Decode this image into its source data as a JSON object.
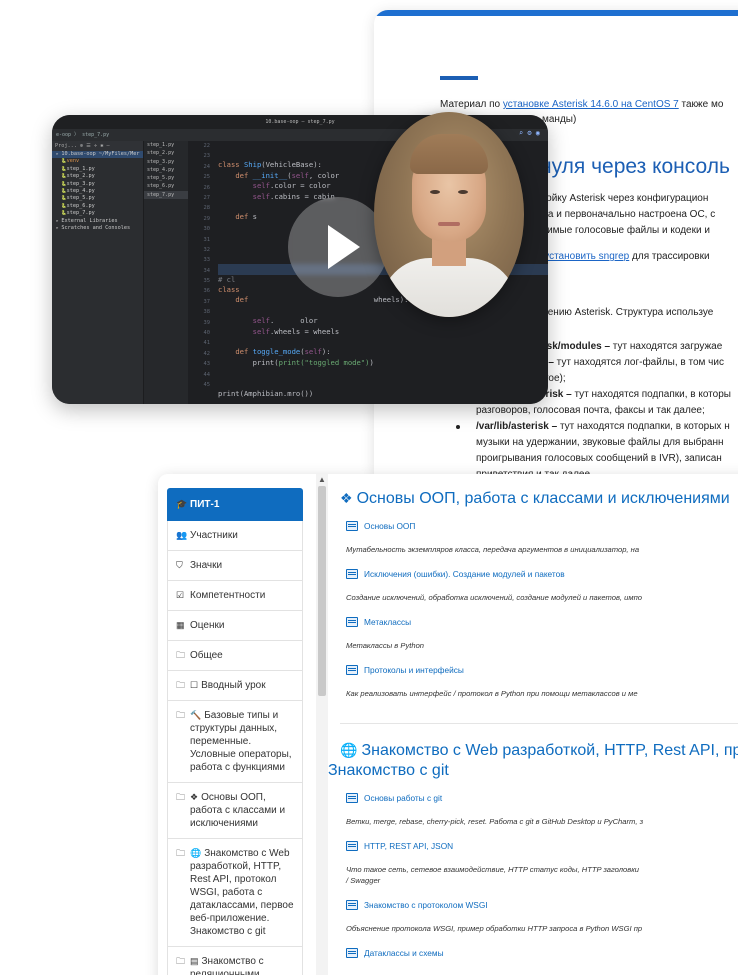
{
  "doc": {
    "material_prefix": "Материал по ",
    "material_link": "установке Asterisk 14.6.0 на CentOS 7",
    "material_suffix": " также мо",
    "material_line2": "манды)",
    "heading": "нуля через консоль",
    "para1": "стройку Asterisk через конфигурацион",
    "para2": "лена и первоначально настроена ОС, с",
    "para3": "ходимые голосовые файлы и кодеки и",
    "para4_prefix": "ся ",
    "para4_link": "установить sngrep",
    "para4_suffix": " для трассировки",
    "para5": "едрению Asterisk. Структура используе",
    "li1_bold": "risk/modules –",
    "li1_text": " тут находятся загружае",
    "li2_bold": "k –",
    "li2_text": " тут находятся лог-файлы, в том чис",
    "li2_line2": "угое);",
    "li3_bold": "erisk –",
    "li3_text": " тут находятся подпапки, в которы",
    "li3_line2": "разговоров, голосовая почта, факсы и так далее;",
    "li4_bold": "/var/lib/asterisk –",
    "li4_text": " тут находятся подпапки, в которых н",
    "li4_line2": "музыки на удержании, звуковые файлы для выбранн",
    "li4_line3": "проигрывания голосовых сообщений в IVR), записан",
    "li4_line4": "приветствия и так далее"
  },
  "ide": {
    "window_title": "10.base-oop – step_7.py",
    "breadcrumb": "e-oop 〉 step_7.py",
    "project_header": "Proj...  ⊕  ☰  ÷  ✱  —",
    "tree": [
      {
        "label": "10.base-oop ~/MyFiles/Mer",
        "level": 0,
        "sel": true
      },
      {
        "label": "venv",
        "level": 1,
        "orange": true
      },
      {
        "label": "step_1.py",
        "level": 1
      },
      {
        "label": "step_2.py",
        "level": 1
      },
      {
        "label": "step_3.py",
        "level": 1
      },
      {
        "label": "step_4.py",
        "level": 1
      },
      {
        "label": "step_5.py",
        "level": 1
      },
      {
        "label": "step_6.py",
        "level": 1
      },
      {
        "label": "step_7.py",
        "level": 1
      },
      {
        "label": "External Libraries",
        "level": 0
      },
      {
        "label": "Scratches and Consoles",
        "level": 0
      }
    ],
    "tabs": [
      "step_1.py",
      "step_2.py",
      "step_3.py",
      "step_4.py",
      "step_5.py",
      "step_6.py",
      "step_7.py"
    ],
    "line_numbers": [
      "22",
      "23",
      "24",
      "25",
      "26",
      "27",
      "28",
      "29",
      "30",
      "31",
      "32",
      "33",
      "34",
      "35",
      "36",
      "37",
      "38",
      "39",
      "40",
      "41",
      "42",
      "43",
      "44",
      "45"
    ],
    "code_print": "print(Amphibian.mro())",
    "code_toggle_print": "print(\"toggled mode\")"
  },
  "course": {
    "sidebar": [
      {
        "icon": "graduation-cap-icon",
        "glyph": "🎓",
        "label": "ПИТ-1",
        "active": true
      },
      {
        "icon": "users-icon",
        "glyph": "👥",
        "label": "Участники"
      },
      {
        "icon": "shield-icon",
        "glyph": "⛉",
        "label": "Значки"
      },
      {
        "icon": "checkbox-icon",
        "glyph": "☑",
        "label": "Компетентности"
      },
      {
        "icon": "grid-icon",
        "glyph": "▦",
        "label": "Оценки"
      },
      {
        "icon": "folder-icon",
        "glyph": "🗀",
        "label": "Общее"
      },
      {
        "icon": "folder-icon",
        "glyph": "🗀",
        "glyph2": "☐",
        "label": "Вводный урок"
      },
      {
        "icon": "folder-icon",
        "glyph": "🗀",
        "glyph2": "🔨",
        "label": "Базовые типы и структуры данных, переменные. Условные операторы, работа с функциями"
      },
      {
        "icon": "folder-icon",
        "glyph": "🗀",
        "glyph2": "❖",
        "label": "Основы ООП, работа с классами и исключениями"
      },
      {
        "icon": "folder-icon",
        "glyph": "🗀",
        "glyph2": "🌐",
        "label": "Знакомство с Web разработкой, HTTP, Rest API, протокол WSGI, работа с датаклассами, первое веб-приложение. Знакомство с git"
      },
      {
        "icon": "folder-icon",
        "glyph": "🗀",
        "glyph2": "▤",
        "label": "Знакомство с реляционными"
      }
    ],
    "sections": [
      {
        "emoji": "❖",
        "title": "Основы ООП, работа с классами и исключениями",
        "activities": [
          {
            "name": "Основы ООП",
            "desc": "Мутабельность экземпляров класса, передача аргументов в инициализатор, на"
          },
          {
            "name": "Исключения (ошибки). Создание модулей и пакетов",
            "desc": "Создание исключений, обработка исключений, создание модулей и пакетов, импо"
          },
          {
            "name": "Метаклассы",
            "desc": "Метаклассы в Python"
          },
          {
            "name": "Протоколы и интерфейсы",
            "desc": "Как реализовать интерфейс / протокол в Python при помощи метаклассов и ме"
          }
        ]
      },
      {
        "emoji": "🌐",
        "title": "Знакомство с Web разработкой, HTTP, Rest API, пр",
        "title_line2": "Знакомство с git",
        "activities": [
          {
            "name": "Основы работы с git",
            "desc": "Ветки, merge, rebase, cherry-pick, reset. Работа с git в GitHub Desktop и PyCharm, з"
          },
          {
            "name": "HTTP, REST API, JSON",
            "desc": "Что такое сеть, сетевое взаимодействие, HTTP статус коды, HTTP заголовки",
            "desc2": "/ Swagger"
          },
          {
            "name": "Знакомство с протоколом WSGI",
            "desc": "Объяснение протокола WSGI, пример обработки HTTP запроса в Python WSGI пр"
          },
          {
            "name": "Датаклассы и схемы",
            "desc": ""
          }
        ]
      }
    ]
  },
  "colors": {
    "brand": "#0f6cbf",
    "doc_accent": "#1c5fb4"
  }
}
